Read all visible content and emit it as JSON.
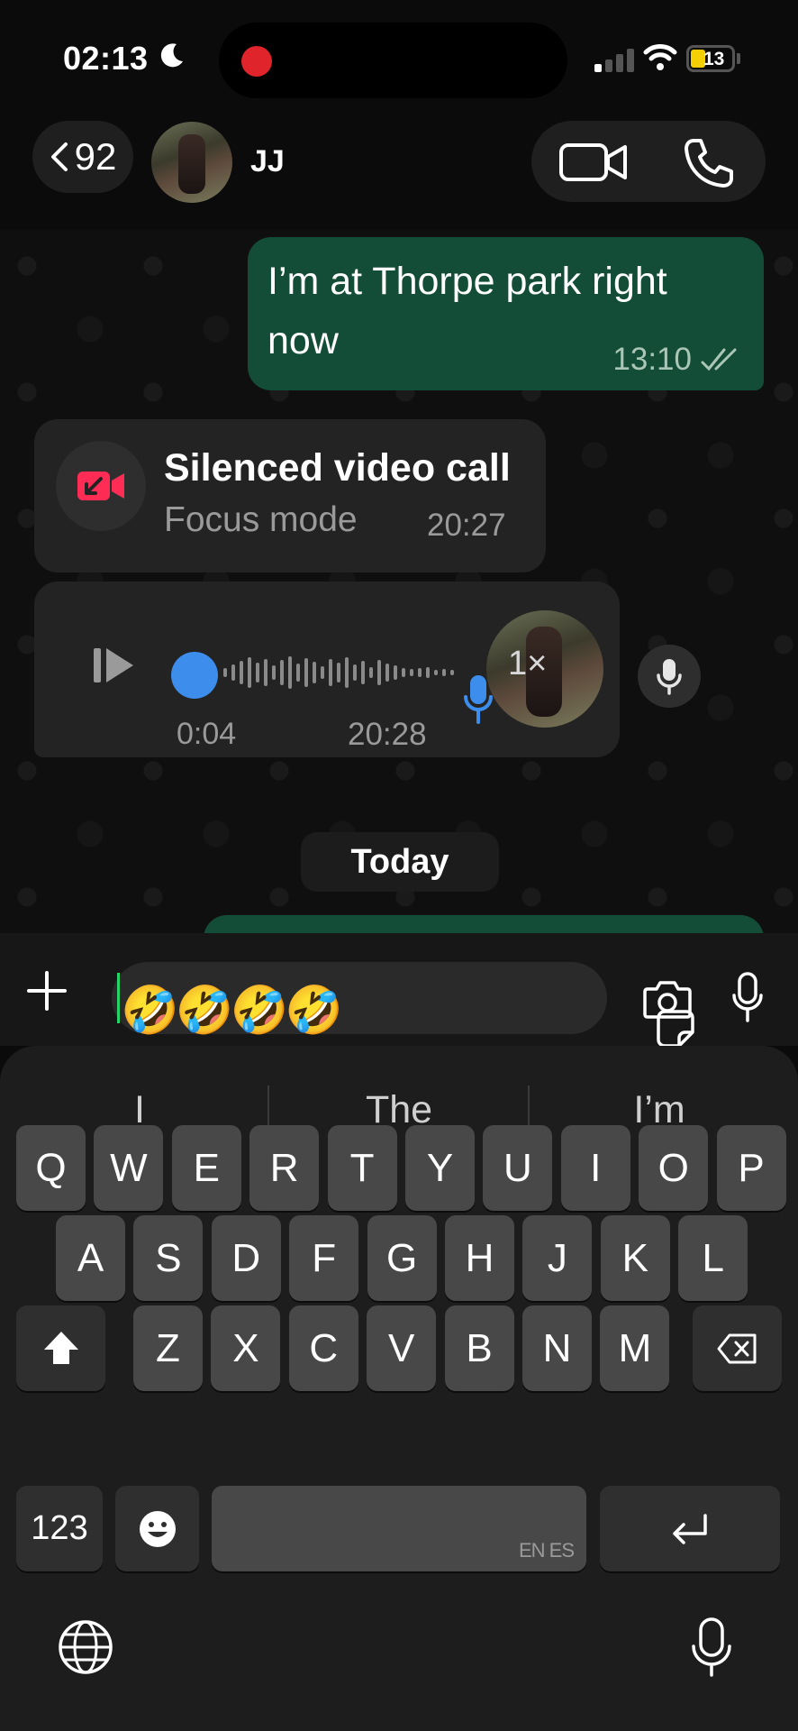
{
  "status_bar": {
    "time": "02:13",
    "focus_icon": "moon-icon",
    "recording_color": "#e0242b",
    "battery_percent": "13",
    "battery_color": "#f5d000",
    "signal_bars_active": 1
  },
  "header": {
    "back_count": "92",
    "contact_name": "JJ",
    "video_icon": "video-camera-icon",
    "phone_icon": "phone-icon"
  },
  "messages": {
    "outgoing_1": {
      "text": "I’m at Thorpe park right now",
      "time": "13:10",
      "status_icon": "double-check-icon"
    },
    "call_event": {
      "title": "Silenced video call",
      "subtitle": "Focus mode",
      "time": "20:27",
      "icon": "missed-video-call-icon",
      "icon_color": "#ff2d55"
    },
    "voice_note": {
      "duration": "0:04",
      "time": "20:28",
      "speed": "1×",
      "progress": 0
    },
    "date_separator": "Today"
  },
  "composer": {
    "input_value": "🤣🤣🤣🤣",
    "accent_color": "#25d366"
  },
  "keyboard": {
    "suggestions": [
      "I",
      "The",
      "I’m"
    ],
    "rows": [
      [
        "Q",
        "W",
        "E",
        "R",
        "T",
        "Y",
        "U",
        "I",
        "O",
        "P"
      ],
      [
        "A",
        "S",
        "D",
        "F",
        "G",
        "H",
        "J",
        "K",
        "L"
      ],
      [
        "Z",
        "X",
        "C",
        "V",
        "B",
        "N",
        "M"
      ]
    ],
    "numbers_label": "123",
    "space_languages": "EN ES"
  },
  "colors": {
    "outgoing_bubble": "#144d37",
    "incoming_bubble": "#232323",
    "key": "#484848",
    "voice_progress": "#3d8eec"
  }
}
